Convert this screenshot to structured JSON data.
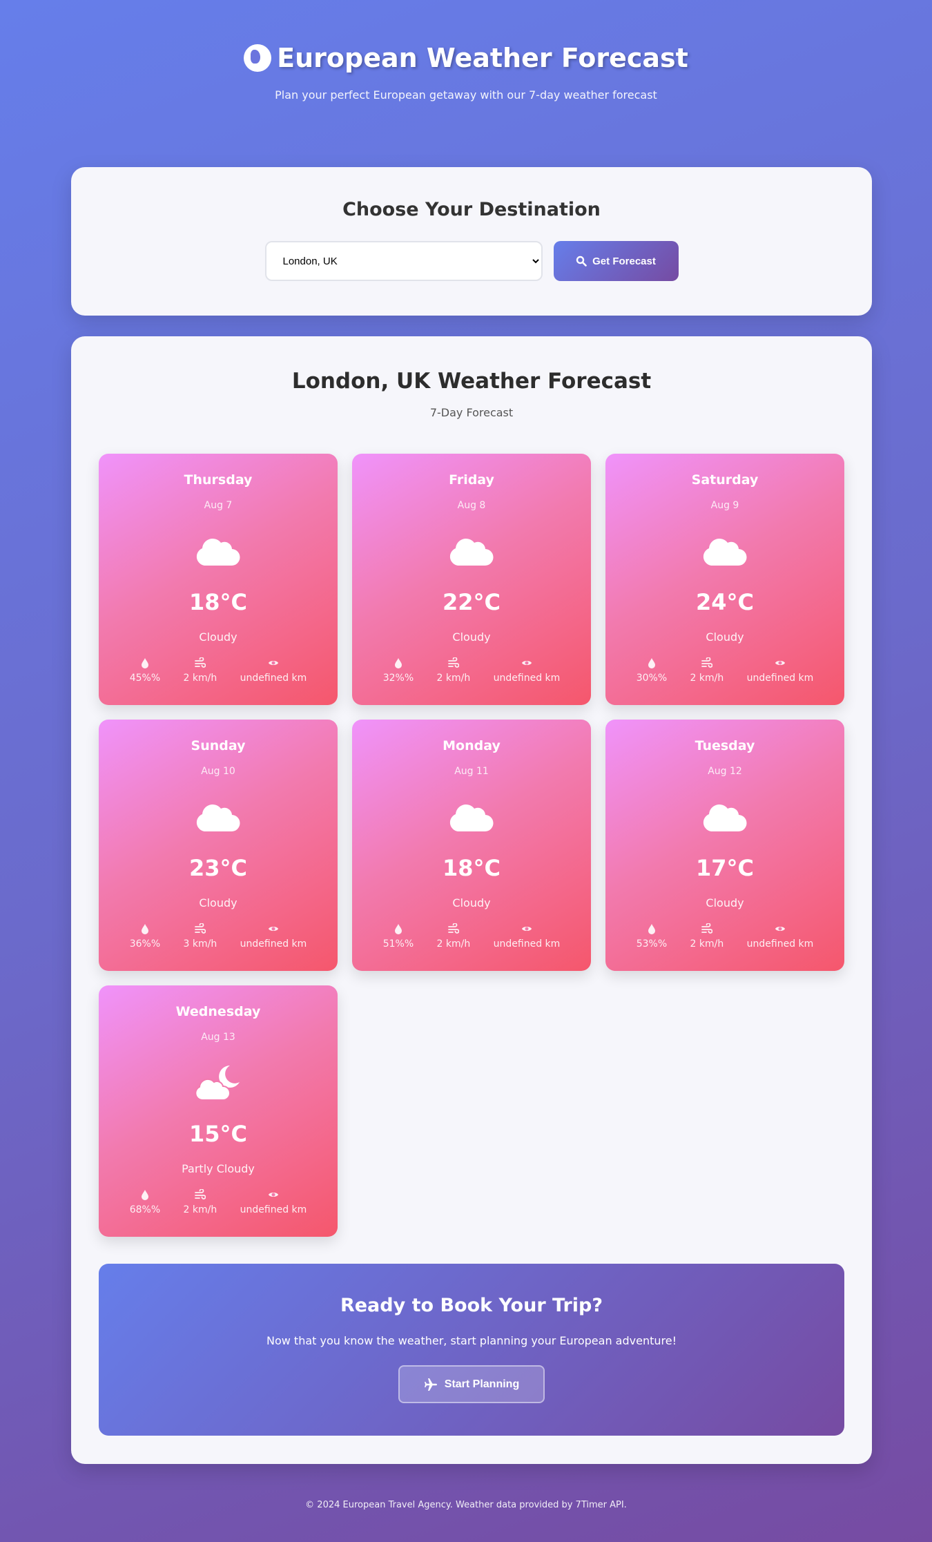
{
  "header": {
    "title": "European Weather Forecast",
    "subtitle": "Plan your perfect European getaway with our 7-day weather forecast",
    "icon": "globe-europe-icon"
  },
  "selector": {
    "heading": "Choose Your Destination",
    "selected": "London, UK",
    "button_label": "Get Forecast",
    "button_icon": "search-icon"
  },
  "forecast": {
    "title": "London, UK Weather Forecast",
    "subtitle": "7-Day Forecast",
    "days": [
      {
        "day": "Thursday",
        "date": "Aug 7",
        "icon": "cloud-icon",
        "temp": "18°C",
        "condition": "Cloudy",
        "humidity": "45%%",
        "wind": "2 km/h",
        "visibility": "undefined km"
      },
      {
        "day": "Friday",
        "date": "Aug 8",
        "icon": "cloud-icon",
        "temp": "22°C",
        "condition": "Cloudy",
        "humidity": "32%%",
        "wind": "2 km/h",
        "visibility": "undefined km"
      },
      {
        "day": "Saturday",
        "date": "Aug 9",
        "icon": "cloud-icon",
        "temp": "24°C",
        "condition": "Cloudy",
        "humidity": "30%%",
        "wind": "2 km/h",
        "visibility": "undefined km"
      },
      {
        "day": "Sunday",
        "date": "Aug 10",
        "icon": "cloud-icon",
        "temp": "23°C",
        "condition": "Cloudy",
        "humidity": "36%%",
        "wind": "3 km/h",
        "visibility": "undefined km"
      },
      {
        "day": "Monday",
        "date": "Aug 11",
        "icon": "cloud-icon",
        "temp": "18°C",
        "condition": "Cloudy",
        "humidity": "51%%",
        "wind": "2 km/h",
        "visibility": "undefined km"
      },
      {
        "day": "Tuesday",
        "date": "Aug 12",
        "icon": "cloud-icon",
        "temp": "17°C",
        "condition": "Cloudy",
        "humidity": "53%%",
        "wind": "2 km/h",
        "visibility": "undefined km"
      },
      {
        "day": "Wednesday",
        "date": "Aug 13",
        "icon": "cloud-moon-icon",
        "temp": "15°C",
        "condition": "Partly Cloudy",
        "humidity": "68%%",
        "wind": "2 km/h",
        "visibility": "undefined km"
      }
    ]
  },
  "cta": {
    "title": "Ready to Book Your Trip?",
    "text": "Now that you know the weather, start planning your European adventure!",
    "button_label": "Start Planning",
    "button_icon": "plane-icon"
  },
  "footer": {
    "text": "© 2024 European Travel Agency. Weather data provided by 7Timer API."
  },
  "colors": {
    "bg_start": "#667eea",
    "bg_end": "#764ba2",
    "card_start": "#f093fb",
    "card_end": "#f5576c"
  }
}
